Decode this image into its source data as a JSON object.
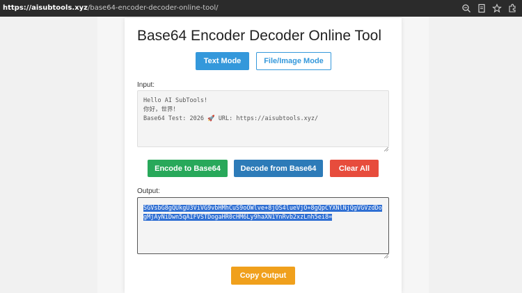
{
  "browser": {
    "url_host": "https://aisubtools.xyz",
    "url_path": "/base64-encoder-decoder-online-tool/",
    "icons": [
      "zoom-icon",
      "reader-icon",
      "star-icon",
      "extensions-icon"
    ]
  },
  "page": {
    "title": "Base64 Encoder Decoder Online Tool"
  },
  "modes": {
    "text_mode_label": "Text Mode",
    "file_mode_label": "File/Image Mode"
  },
  "input": {
    "label": "Input:",
    "value": "Hello AI SubTools!\n你好，世界！\nBase64 Test: 2026 🚀 URL: https://aisubtools.xyz/"
  },
  "actions": {
    "encode_label": "Encode to Base64",
    "decode_label": "Decode from Base64",
    "clear_label": "Clear All"
  },
  "output": {
    "label": "Output:",
    "value": "SGVsbG8gQUkgU3ViVG9vbHMhCuS9oOWlve+8jOS4lueVjO+8gQpCYXNlNjQgVGVzdDogMjAyNiDwn5qAIFVSTDogaHR0cHM6Ly9haXN1YnRvb2xzLnh5ei8="
  },
  "copy": {
    "label": "Copy Output"
  },
  "colors": {
    "primary": "#3498db",
    "success": "#28a85a",
    "secondary_blue": "#2d7bb8",
    "danger": "#e74c3c",
    "warning": "#f0a01c",
    "selection": "#2f6fd3"
  }
}
